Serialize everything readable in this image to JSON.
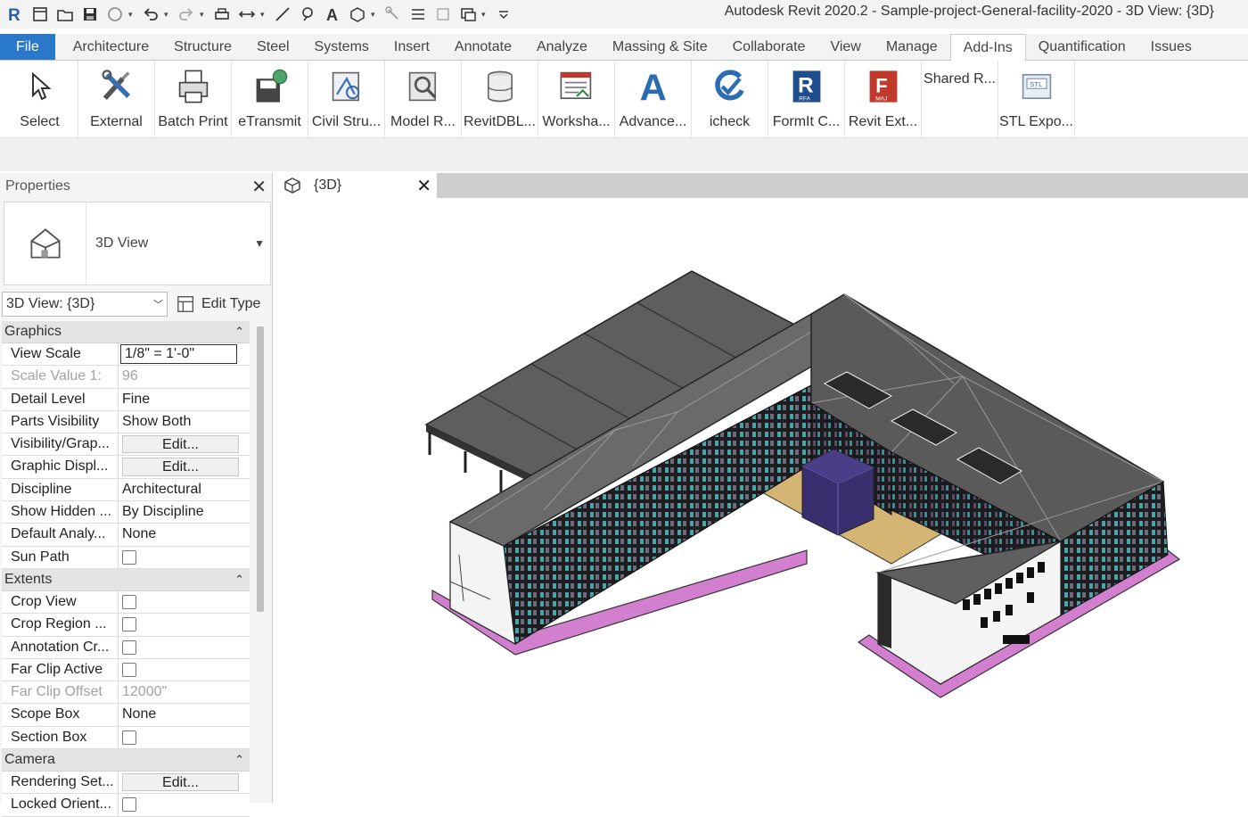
{
  "titlebar": {
    "title": "Autodesk Revit 2020.2 - Sample-project-General-facility-2020 - 3D View: {3D}"
  },
  "tabs": [
    "File",
    "Architecture",
    "Structure",
    "Steel",
    "Systems",
    "Insert",
    "Annotate",
    "Analyze",
    "Massing & Site",
    "Collaborate",
    "View",
    "Manage",
    "Add-Ins",
    "Quantification",
    "Issues"
  ],
  "ribbon": {
    "buttons": [
      {
        "label": "Select",
        "icon": "cursor-icon"
      },
      {
        "label": "External",
        "icon": "tools-icon"
      },
      {
        "label": "Batch Print",
        "icon": "printer-icon"
      },
      {
        "label": "eTransmit",
        "icon": "etransmit-icon"
      },
      {
        "label": "Civil Stru...",
        "icon": "civil-structure-icon"
      },
      {
        "label": "Model R...",
        "icon": "model-review-icon"
      },
      {
        "label": "RevitDBL...",
        "icon": "database-icon"
      },
      {
        "label": "Worksha...",
        "icon": "worksharing-icon"
      },
      {
        "label": "Advance...",
        "icon": "advance-steel-icon"
      },
      {
        "label": "icheck",
        "icon": "check-icon"
      },
      {
        "label": "FormIt C...",
        "icon": "formit-icon"
      },
      {
        "label": "Revit Ext...",
        "icon": "revit-extension-icon"
      },
      {
        "label": "Shared R...",
        "icon": "none"
      },
      {
        "label": "STL Expo...",
        "icon": "stl-export-icon"
      }
    ]
  },
  "properties": {
    "title": "Properties",
    "type_name": "3D View",
    "view_selector": "3D View: {3D}",
    "edit_type": "Edit Type",
    "sections": [
      {
        "name": "Graphics",
        "rows": [
          {
            "key": "View Scale",
            "value": "1/8\" = 1'-0\"",
            "style": "boxed"
          },
          {
            "key": "Scale Value    1:",
            "value": "96",
            "style": "dim"
          },
          {
            "key": "Detail Level",
            "value": "Fine"
          },
          {
            "key": "Parts Visibility",
            "value": "Show Both"
          },
          {
            "key": "Visibility/Grap...",
            "value": "Edit...",
            "style": "btn"
          },
          {
            "key": "Graphic Displ...",
            "value": "Edit...",
            "style": "btn"
          },
          {
            "key": "Discipline",
            "value": "Architectural"
          },
          {
            "key": "Show Hidden ...",
            "value": "By Discipline"
          },
          {
            "key": "Default Analy...",
            "value": "None"
          },
          {
            "key": "Sun Path",
            "value": "",
            "style": "check"
          }
        ]
      },
      {
        "name": "Extents",
        "rows": [
          {
            "key": "Crop View",
            "value": "",
            "style": "check"
          },
          {
            "key": "Crop Region ...",
            "value": "",
            "style": "check"
          },
          {
            "key": "Annotation Cr...",
            "value": "",
            "style": "check"
          },
          {
            "key": "Far Clip Active",
            "value": "",
            "style": "check"
          },
          {
            "key": "Far Clip Offset",
            "value": "12000\"",
            "style": "dim"
          },
          {
            "key": "Scope Box",
            "value": "None"
          },
          {
            "key": "Section Box",
            "value": "",
            "style": "check"
          }
        ]
      },
      {
        "name": "Camera",
        "rows": [
          {
            "key": "Rendering Set...",
            "value": "Edit...",
            "style": "btn"
          },
          {
            "key": "Locked Orient...",
            "value": "",
            "style": "check"
          }
        ]
      }
    ]
  },
  "view": {
    "tab_label": "{3D}"
  },
  "colors": {
    "file_tab": "#2a78c9",
    "roof": "#5d5d5d",
    "courtyard": "#d4b574",
    "pad_edge": "#e7a6e0"
  }
}
